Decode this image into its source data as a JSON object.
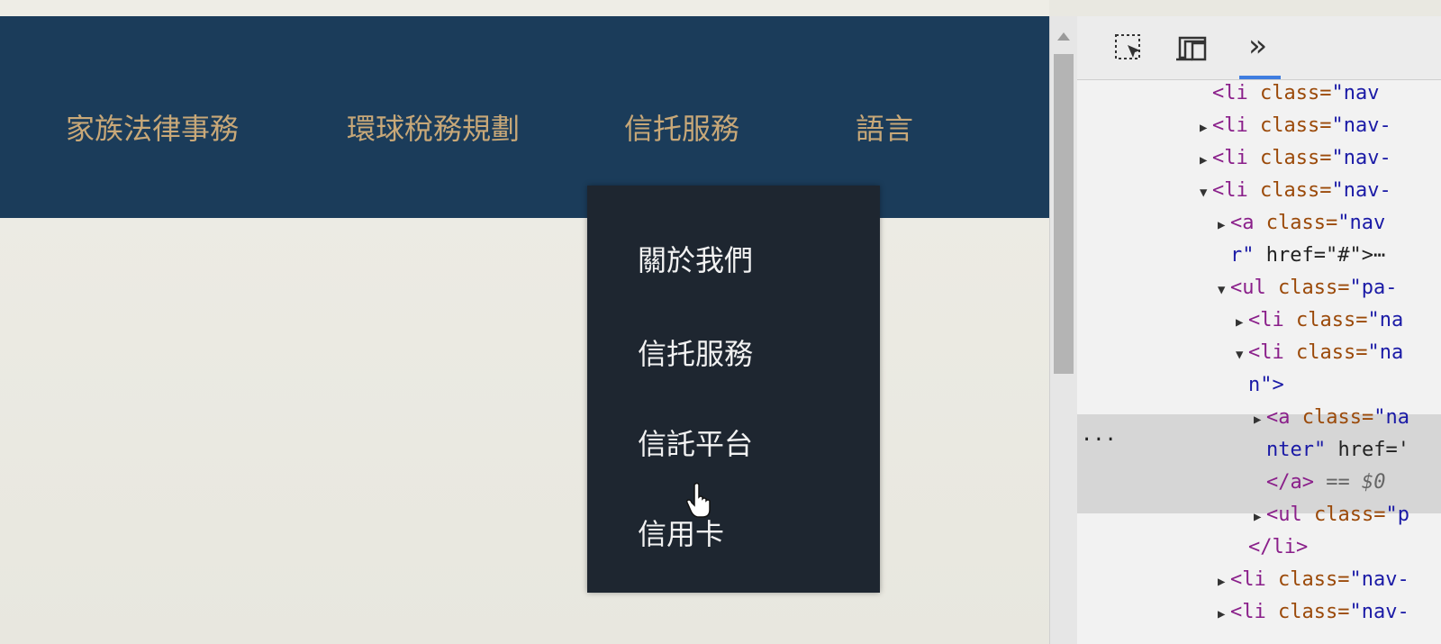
{
  "navbar": {
    "items": [
      {
        "label": "家族法律事務"
      },
      {
        "label": "環球稅務規劃"
      },
      {
        "label": "信托服務"
      },
      {
        "label": "語言"
      }
    ]
  },
  "dropdown": {
    "items": [
      {
        "label": "關於我們"
      },
      {
        "label": "信托服務"
      },
      {
        "label": "信託平台"
      },
      {
        "label": "信用卡"
      }
    ]
  },
  "devtools": {
    "more_tabs_label": "»",
    "lines": [
      {
        "indent": 1,
        "arrow": "",
        "tag": "<li",
        "attr": " class=",
        "val": "\"nav",
        "rest": ""
      },
      {
        "indent": 1,
        "arrow": "▶",
        "tag": "<li",
        "attr": " class=",
        "val": "\"nav-",
        "rest": ""
      },
      {
        "indent": 1,
        "arrow": "▶",
        "tag": "<li",
        "attr": " class=",
        "val": "\"nav-",
        "rest": ""
      },
      {
        "indent": 1,
        "arrow": "▼",
        "tag": "<li",
        "attr": " class=",
        "val": "\"nav-",
        "rest": ""
      },
      {
        "indent": 2,
        "arrow": "▶",
        "tag": "<a",
        "attr": " class=",
        "val": "\"nav",
        "rest": ""
      },
      {
        "indent": 2,
        "arrow": "",
        "tag": "",
        "attr": "",
        "val": "r\"",
        "rest": " href=\"#\">⋯"
      },
      {
        "indent": 2,
        "arrow": "▼",
        "tag": "<ul",
        "attr": " class=",
        "val": "\"pa-",
        "rest": ""
      },
      {
        "indent": 3,
        "arrow": "▶",
        "tag": "<li",
        "attr": " class=",
        "val": "\"na",
        "rest": ""
      },
      {
        "indent": 3,
        "arrow": "▼",
        "tag": "<li",
        "attr": " class=",
        "val": "\"na",
        "rest": ""
      },
      {
        "indent": 3,
        "arrow": "",
        "tag": "",
        "attr": "",
        "val": "n\">",
        "rest": ""
      },
      {
        "indent": 4,
        "arrow": "▶",
        "tag": "<a",
        "attr": " class=",
        "val": "\"na",
        "rest": ""
      },
      {
        "indent": 4,
        "arrow": "",
        "tag": "",
        "attr": "",
        "val": "nter\"",
        "rest": " href='"
      },
      {
        "indent": 4,
        "arrow": "",
        "tag": "</a>",
        "attr": "",
        "val": "",
        "rest": " == $0"
      },
      {
        "indent": 4,
        "arrow": "▶",
        "tag": "<ul",
        "attr": " class=",
        "val": "\"p",
        "rest": ""
      },
      {
        "indent": 3,
        "arrow": "",
        "tag": "</li>",
        "attr": "",
        "val": "",
        "rest": ""
      },
      {
        "indent": 2,
        "arrow": "▶",
        "tag": "<li",
        "attr": " class=",
        "val": "\"nav-",
        "rest": ""
      },
      {
        "indent": 2,
        "arrow": "▶",
        "tag": "<li",
        "attr": " class=",
        "val": "\"nav-",
        "rest": ""
      }
    ],
    "selection_marker": "..."
  }
}
